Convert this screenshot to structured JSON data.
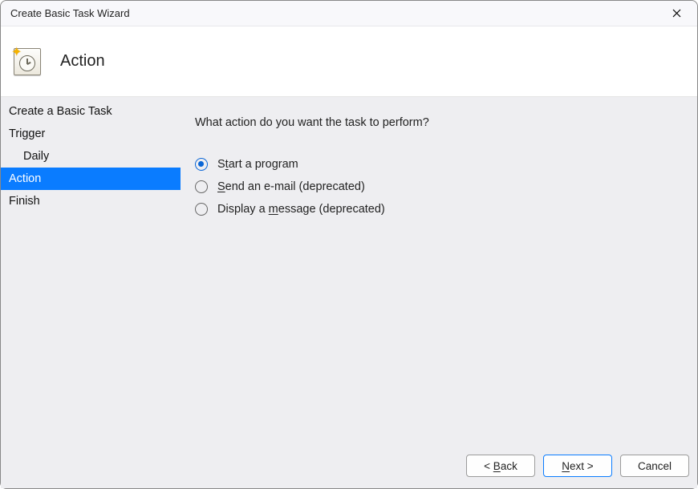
{
  "window": {
    "title": "Create Basic Task Wizard"
  },
  "header": {
    "title": "Action"
  },
  "sidebar": {
    "items": [
      {
        "label": "Create a Basic Task",
        "indent": false,
        "selected": false
      },
      {
        "label": "Trigger",
        "indent": false,
        "selected": false
      },
      {
        "label": "Daily",
        "indent": true,
        "selected": false
      },
      {
        "label": "Action",
        "indent": false,
        "selected": true
      },
      {
        "label": "Finish",
        "indent": false,
        "selected": false
      }
    ]
  },
  "content": {
    "prompt": "What action do you want the task to perform?",
    "options": [
      {
        "id": "start-program",
        "pre": "S",
        "u": "t",
        "post": "art a program",
        "checked": true
      },
      {
        "id": "send-email",
        "pre": "",
        "u": "S",
        "post": "end an e-mail (deprecated)",
        "checked": false
      },
      {
        "id": "display-message",
        "pre": "Display a ",
        "u": "m",
        "post": "essage (deprecated)",
        "checked": false
      }
    ]
  },
  "footer": {
    "back": {
      "lt": "< ",
      "u": "B",
      "rest": "ack"
    },
    "next": {
      "u": "N",
      "rest": "ext >"
    },
    "cancel": "Cancel"
  }
}
